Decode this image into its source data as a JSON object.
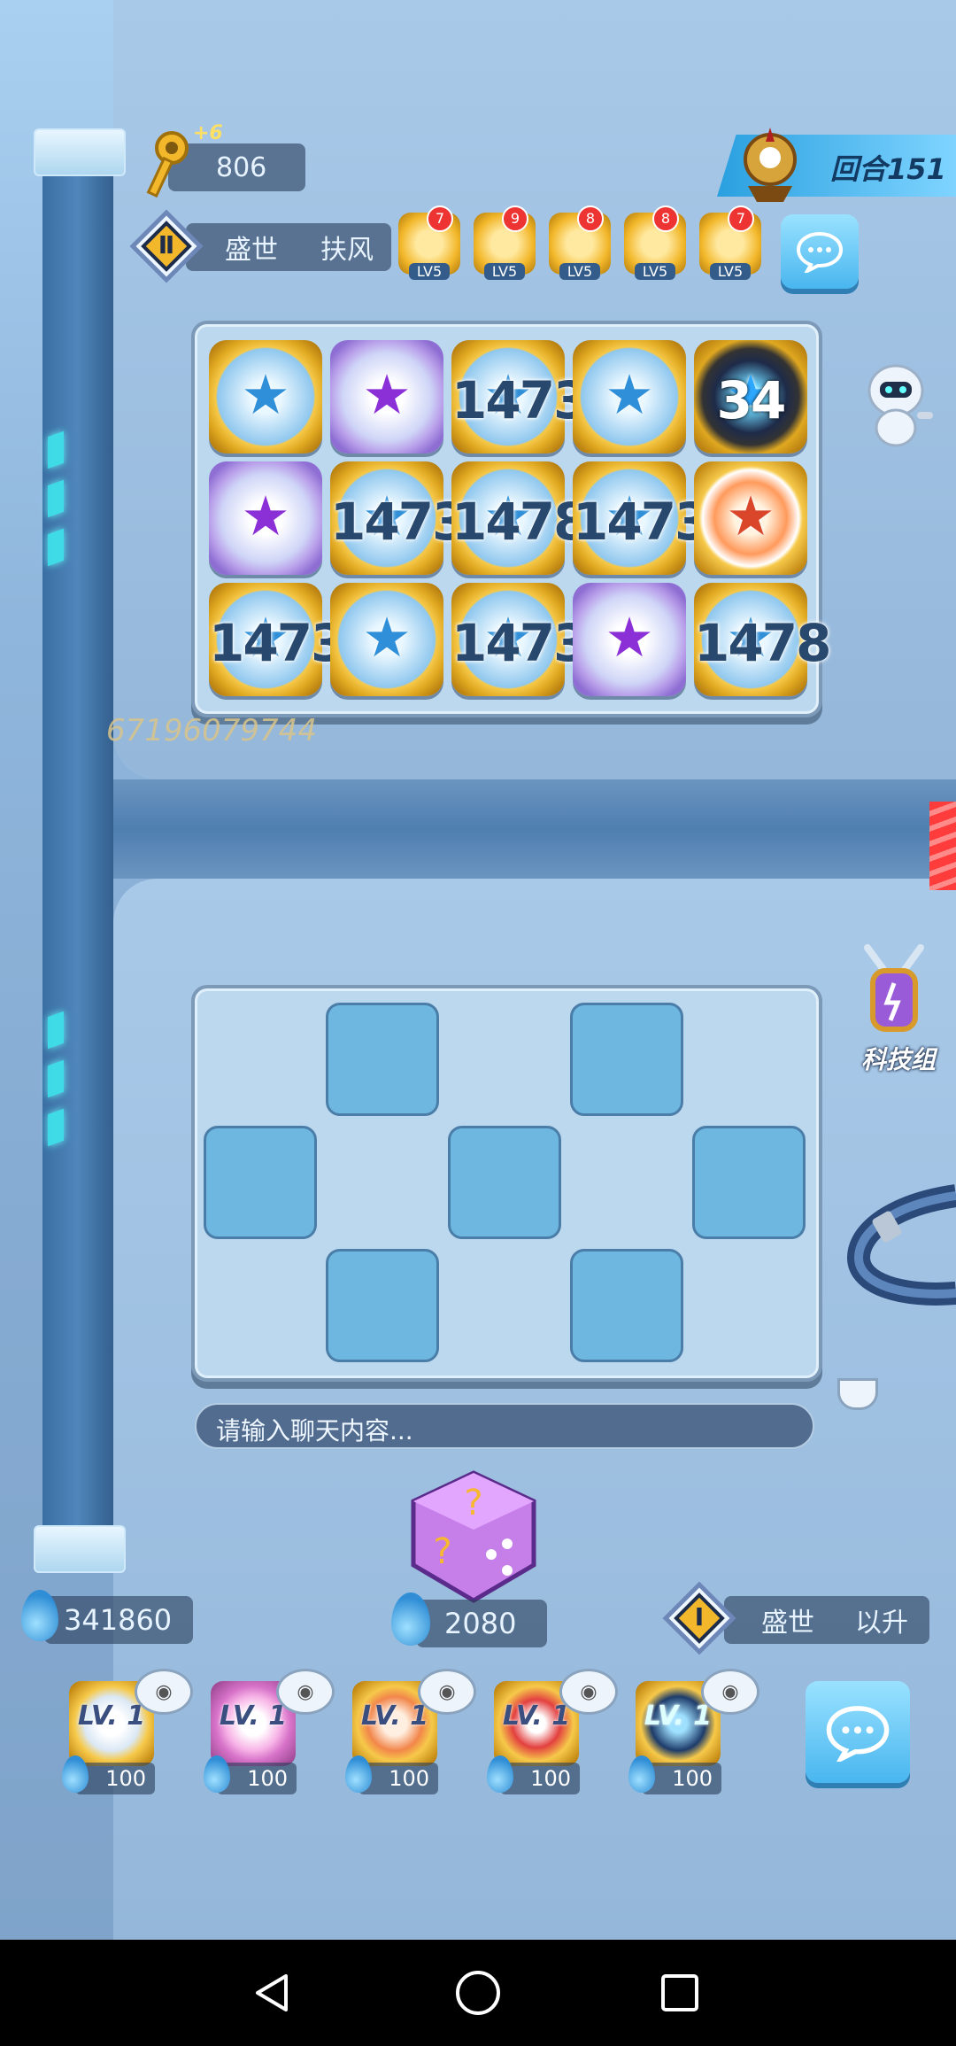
{
  "hud": {
    "keys": {
      "value": "806",
      "bonus": "+6",
      "icon": "gold-key-icon"
    },
    "round": {
      "label": "回合151"
    }
  },
  "opponent": {
    "rank_roman": "Ⅱ",
    "name_left": "盛世",
    "name_right": "扶风",
    "score": "67196079744",
    "badges": [
      {
        "lv": "LV5",
        "count": "7"
      },
      {
        "lv": "LV5",
        "count": "9"
      },
      {
        "lv": "LV5",
        "count": "8"
      },
      {
        "lv": "LV5",
        "count": "8"
      },
      {
        "lv": "LV5",
        "count": "7"
      }
    ]
  },
  "top_board": {
    "rows": [
      [
        {
          "kind": "gold",
          "label": ""
        },
        {
          "kind": "purple",
          "label": ""
        },
        {
          "kind": "gold",
          "label": "1473"
        },
        {
          "kind": "gold",
          "label": ""
        },
        {
          "kind": "dark",
          "label": "34"
        }
      ],
      [
        {
          "kind": "purple",
          "label": ""
        },
        {
          "kind": "gold",
          "label": "1473"
        },
        {
          "kind": "gold",
          "label": "1478"
        },
        {
          "kind": "gold",
          "label": "1473"
        },
        {
          "kind": "fire",
          "label": ""
        }
      ],
      [
        {
          "kind": "gold",
          "label": "1473"
        },
        {
          "kind": "gold",
          "label": ""
        },
        {
          "kind": "gold",
          "label": "1473"
        },
        {
          "kind": "purple",
          "label": ""
        },
        {
          "kind": "gold",
          "label": "1478"
        }
      ]
    ]
  },
  "side": {
    "tech_group_label": "科技组"
  },
  "chat": {
    "placeholder": "请输入聊天内容..."
  },
  "player": {
    "water": "341860",
    "dice_cost": "2080",
    "rank_roman": "Ⅰ",
    "name_left": "盛世",
    "name_right": "以升",
    "cards": [
      {
        "lv": "LV. 1",
        "cost": "100"
      },
      {
        "lv": "LV. 1",
        "cost": "100"
      },
      {
        "lv": "LV. 1",
        "cost": "100"
      },
      {
        "lv": "LV. 1",
        "cost": "100"
      },
      {
        "lv": "LV. 1",
        "cost": "100"
      }
    ]
  },
  "colors": {
    "accent": "#49b6ef",
    "gold": "#f2b72a",
    "star_blue": "#2f8fd8",
    "star_purple": "#8b2fd6"
  }
}
